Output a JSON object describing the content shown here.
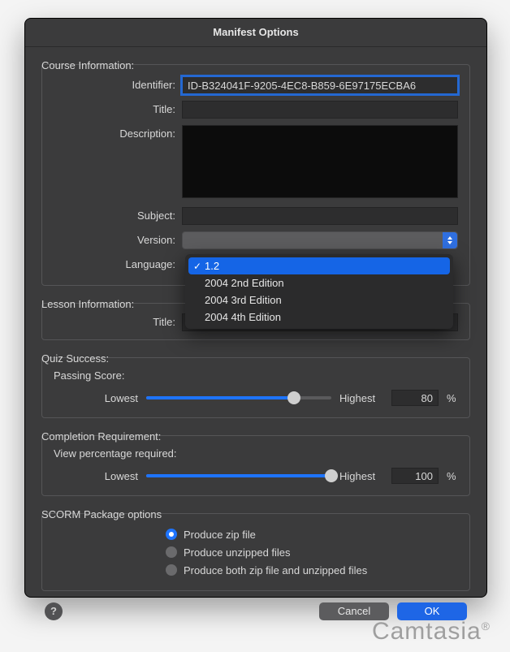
{
  "window_title": "Manifest Options",
  "course": {
    "section": "Course Information:",
    "identifier_label": "Identifier:",
    "identifier_value": "ID-B324041F-9205-4EC8-B859-6E97175ECBA6",
    "title_label": "Title:",
    "title_value": "",
    "description_label": "Description:",
    "description_value": "",
    "subject_label": "Subject:",
    "subject_value": "",
    "version_label": "Version:",
    "version_options": [
      {
        "label": "1.2",
        "selected": true
      },
      {
        "label": "2004 2nd Edition",
        "selected": false
      },
      {
        "label": "2004 3rd Edition",
        "selected": false
      },
      {
        "label": "2004 4th Edition",
        "selected": false
      }
    ],
    "language_label": "Language:"
  },
  "lesson": {
    "section": "Lesson Information:",
    "title_label": "Title:",
    "title_value": ""
  },
  "quiz": {
    "section": "Quiz Success:",
    "passing_label": "Passing Score:",
    "lowest": "Lowest",
    "highest": "Highest",
    "value": 80,
    "unit": "%"
  },
  "completion": {
    "section": "Completion Requirement:",
    "view_label": "View percentage required:",
    "lowest": "Lowest",
    "highest": "Highest",
    "value": 100,
    "unit": "%"
  },
  "scorm": {
    "section": "SCORM Package options",
    "options": [
      {
        "label": "Produce zip file",
        "checked": true
      },
      {
        "label": "Produce unzipped files",
        "checked": false
      },
      {
        "label": "Produce both zip file and unzipped files",
        "checked": false
      }
    ]
  },
  "footer": {
    "cancel": "Cancel",
    "ok": "OK",
    "help": "?"
  },
  "watermark": "Camtasia"
}
